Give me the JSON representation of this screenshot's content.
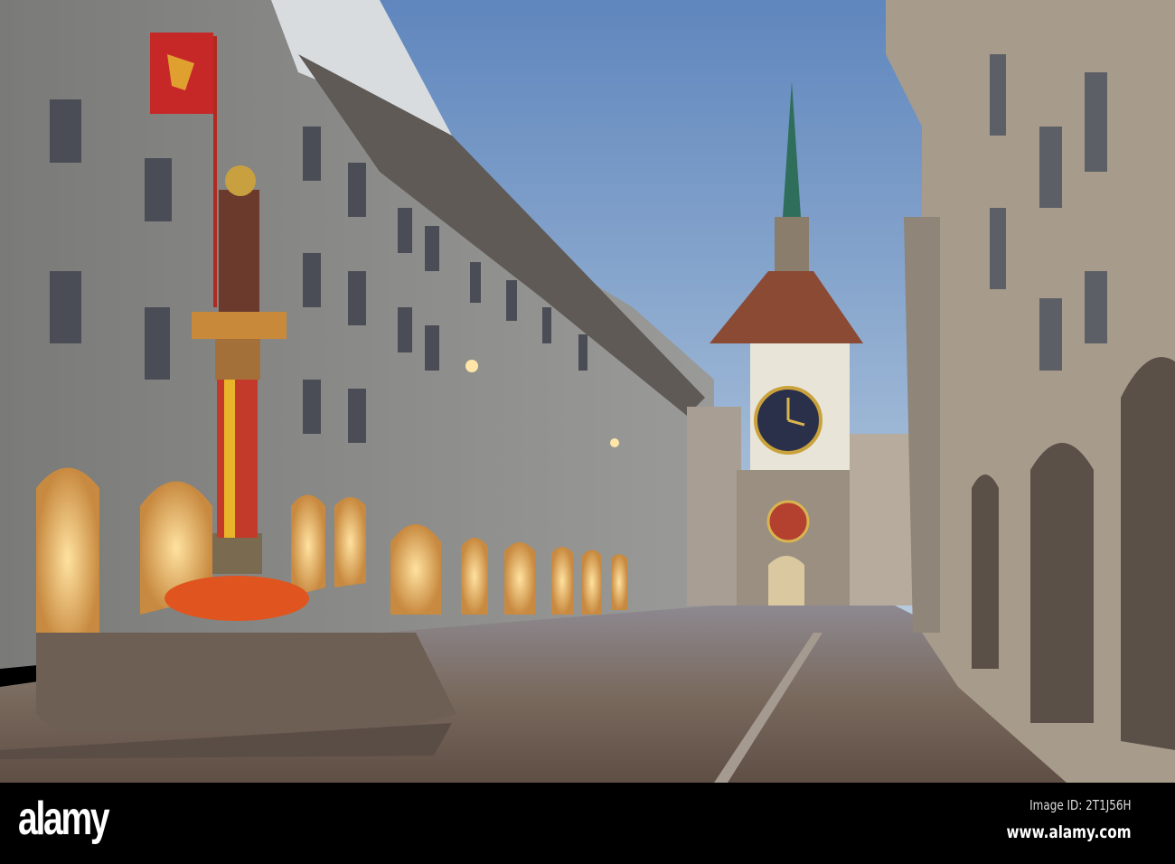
{
  "watermark": {
    "logo": "alamy",
    "image_id": "Image ID: 2T1J56H",
    "website": "www.alamy.com"
  },
  "colors": {
    "sky_top": "#5f86bd",
    "sky_bottom": "#b9cde0",
    "facade": "#8d8d8a",
    "lamp": "#f3c46a",
    "cobblestone": "#7a6a5e",
    "roof": "#8a4a34",
    "spire": "#2f6e5a",
    "flowers": "#e0551f"
  }
}
